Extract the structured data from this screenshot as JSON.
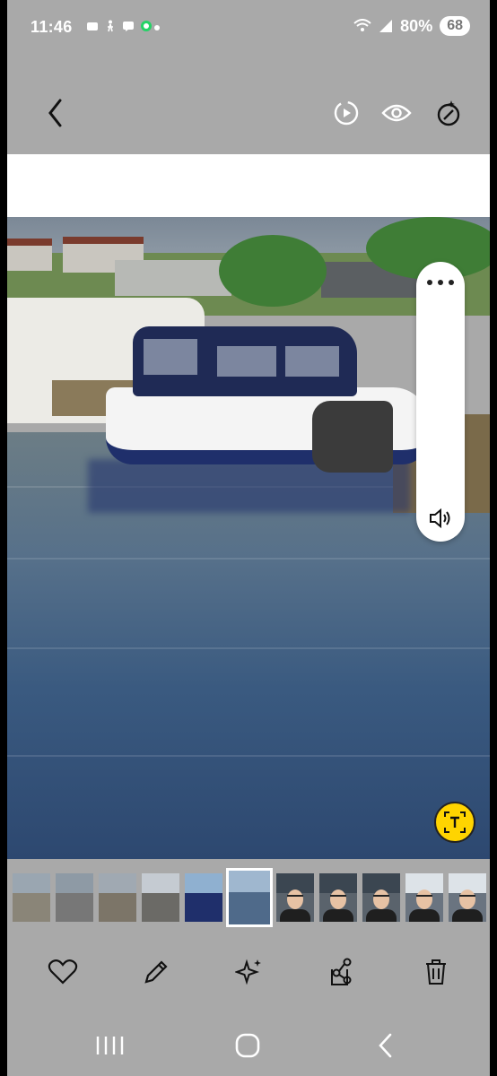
{
  "status_bar": {
    "time": "11:46",
    "battery": "80%",
    "battery_pill": "68",
    "icons": [
      "notification-icon",
      "walk-icon",
      "messages-icon",
      "whatsapp-icon",
      "wifi-icon",
      "signal-icon"
    ]
  },
  "top_bar": {
    "back_icon": "chevron-left-icon",
    "motion_icon": "motion-photo-icon",
    "view_icon": "eye-icon",
    "remaster_icon": "remaster-icon"
  },
  "photo": {
    "description_icon": "boat-in-harbor-photo"
  },
  "volume_slider": {
    "menu_icon": "more-dots-icon",
    "speaker_icon": "speaker-icon"
  },
  "text_button": {
    "icon": "text-extract-icon",
    "color": "#ffd400"
  },
  "filmstrip": {
    "thumbnails": [
      {
        "kind": "boat"
      },
      {
        "kind": "boat"
      },
      {
        "kind": "boat"
      },
      {
        "kind": "boat"
      },
      {
        "kind": "boat"
      },
      {
        "kind": "boat-active"
      },
      {
        "kind": "selfie"
      },
      {
        "kind": "selfie"
      },
      {
        "kind": "selfie"
      },
      {
        "kind": "selfie"
      },
      {
        "kind": "selfie"
      }
    ]
  },
  "actions": {
    "favorite_icon": "heart-icon",
    "edit_icon": "pencil-icon",
    "ai_icon": "sparkle-icon",
    "share_icon": "share-icon",
    "delete_icon": "trash-icon"
  },
  "navbar": {
    "recent_icon": "recent-apps-icon",
    "home_icon": "home-icon",
    "back_icon": "back-icon"
  }
}
